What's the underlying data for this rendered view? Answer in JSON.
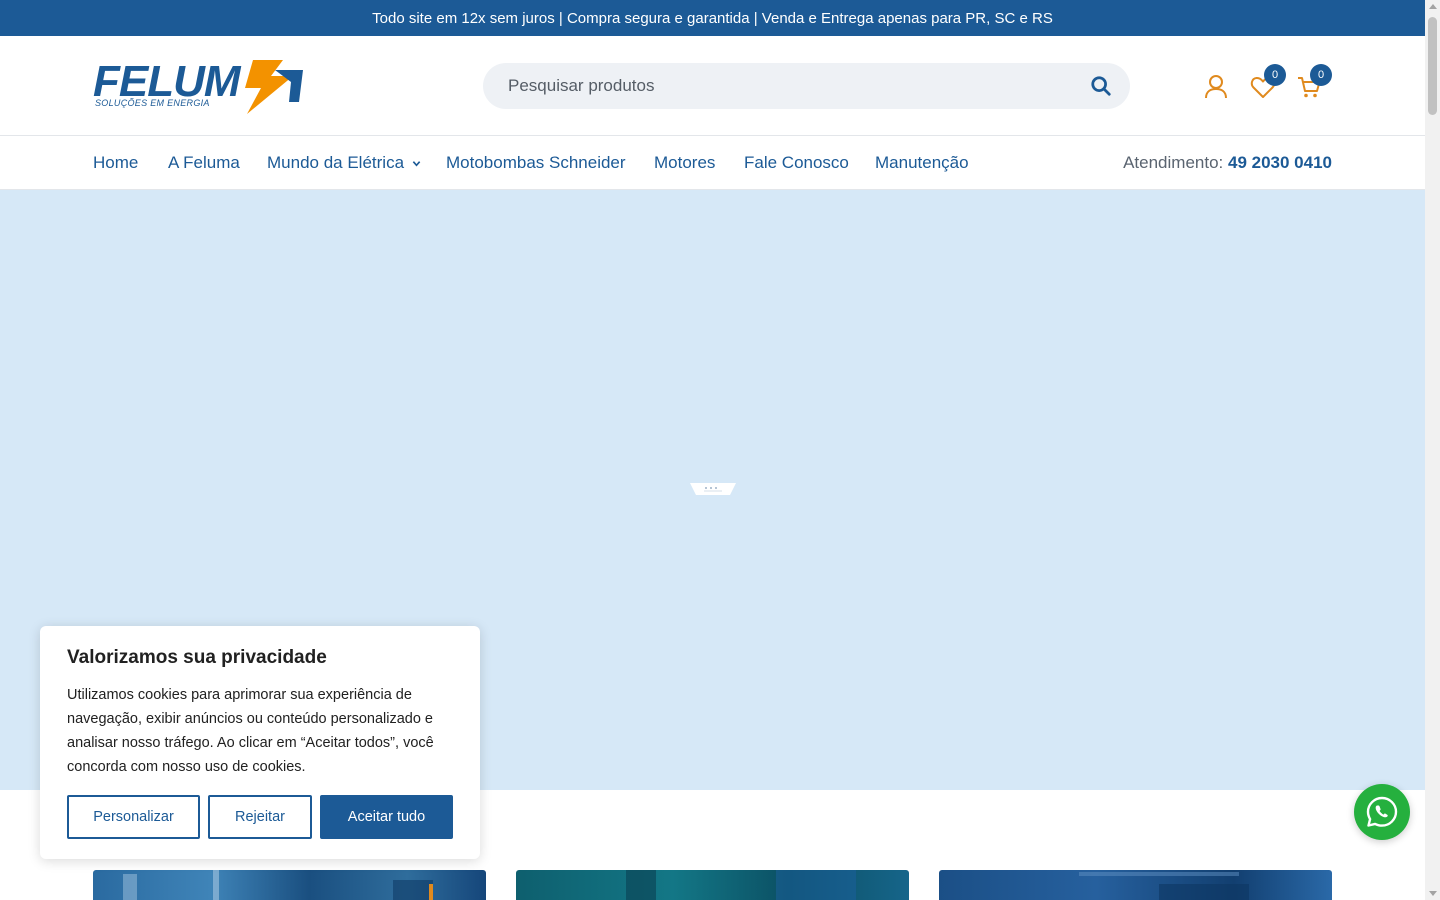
{
  "topbar": {
    "text": "Todo site em 12x sem juros | Compra segura e garantida | Venda e Entrega apenas para PR, SC e RS"
  },
  "logo": {
    "word": "FELUM",
    "tagline": "SOLUÇÕES EM ENERGIA",
    "colors": {
      "blue": "#1c5a96",
      "orange": "#f39200"
    }
  },
  "search": {
    "placeholder": "Pesquisar produtos",
    "value": "",
    "icon": "search-icon"
  },
  "header_actions": {
    "account_icon": "user-icon",
    "wishlist_icon": "heart-icon",
    "wishlist_count": "0",
    "cart_icon": "cart-icon",
    "cart_count": "0"
  },
  "nav": {
    "items": [
      {
        "label": "Home"
      },
      {
        "label": "A Feluma"
      },
      {
        "label": "Mundo da Elétrica",
        "has_dropdown": true
      },
      {
        "label": "Motobombas Schneider"
      },
      {
        "label": "Motores"
      },
      {
        "label": "Fale Conosco"
      },
      {
        "label": "Manutenção"
      }
    ],
    "contact_label": "Atendimento:",
    "contact_phone": "49 2030 0410"
  },
  "hero": {
    "background": "#d6e8f7"
  },
  "cookie_banner": {
    "title": "Valorizamos sua privacidade",
    "text": "Utilizamos cookies para aprimorar sua experiência de navegação, exibir anúncios ou conteúdo personalizado e analisar nosso tráfego. Ao clicar em “Aceitar todos”, você concorda com nosso uso de cookies.",
    "customize_label": "Personalizar",
    "reject_label": "Rejeitar",
    "accept_label": "Aceitar tudo"
  },
  "floating": {
    "whatsapp_icon": "whatsapp-icon",
    "color": "#25b03e"
  },
  "colors": {
    "brand_blue": "#1c5a96",
    "accent_orange": "#e08a1e"
  }
}
